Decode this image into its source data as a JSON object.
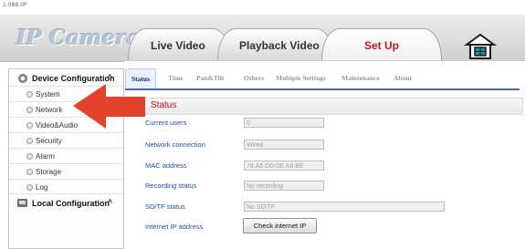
{
  "window": {
    "corner_label": "1.088.0P"
  },
  "header": {
    "brand": "IP Camera",
    "tabs": [
      {
        "label": "Live Video",
        "active": false
      },
      {
        "label": "Playback Video",
        "active": false
      },
      {
        "label": "Set Up",
        "active": true
      }
    ]
  },
  "sidebar": {
    "sections": [
      {
        "label": "Device Configuration",
        "caret": "^",
        "items": [
          "System",
          "Network",
          "Video&Audio",
          "Security",
          "Alarm",
          "Storage",
          "Log"
        ]
      },
      {
        "label": "Local Configuration",
        "caret": "^"
      }
    ]
  },
  "subtabs": [
    "Status",
    "Time",
    "Pan&Tilt",
    "Others",
    "Multiple Settings",
    "Maintenance",
    "About"
  ],
  "status": {
    "section_title": "Status",
    "rows": [
      {
        "label": "Current users",
        "value": "0"
      },
      {
        "label": "Network connection",
        "value": "Wired"
      },
      {
        "label": "MAC address",
        "value": "78:A5:DD:0E:A8:BE"
      },
      {
        "label": "Recording status",
        "value": "No recording"
      },
      {
        "label": "SD/TF status",
        "value": "No SD/TF"
      }
    ],
    "internet_ip_label": "Internet IP address",
    "check_button": "Check internet IP"
  },
  "colors": {
    "accent_red": "#c4161c",
    "link_blue": "#1e4ea8",
    "tab_underline": "#4a68b4",
    "annotation_arrow": "#e3432b"
  }
}
